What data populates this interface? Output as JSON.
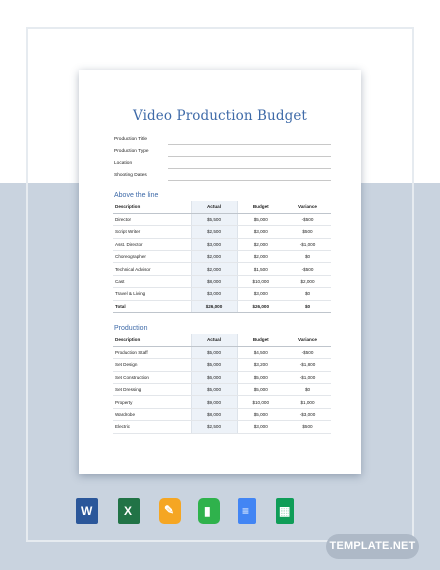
{
  "document": {
    "title": "Video Production Budget",
    "info_fields": [
      "Production Title",
      "Production Type",
      "Location",
      "Shooting Dates"
    ]
  },
  "sections": [
    {
      "title": "Above the line",
      "columns": [
        "Description",
        "Actual",
        "Budget",
        "Variance"
      ],
      "rows": [
        [
          "Director",
          "$5,500",
          "$5,000",
          "-$500"
        ],
        [
          "Script Writer",
          "$2,500",
          "$3,000",
          "$500"
        ],
        [
          "Asst. Director",
          "$3,000",
          "$2,000",
          "-$1,000"
        ],
        [
          "Choreographer",
          "$2,000",
          "$2,000",
          "$0"
        ],
        [
          "Technical Advisor",
          "$2,000",
          "$1,500",
          "-$500"
        ],
        [
          "Cast",
          "$8,000",
          "$10,000",
          "$2,000"
        ],
        [
          "Travel & Living",
          "$3,000",
          "$3,000",
          "$0"
        ]
      ],
      "total": [
        "Total",
        "$26,000",
        "$26,000",
        "$0"
      ]
    },
    {
      "title": "Production",
      "columns": [
        "Description",
        "Actual",
        "Budget",
        "Variance"
      ],
      "rows": [
        [
          "Production Staff",
          "$5,000",
          "$4,500",
          "-$500"
        ],
        [
          "Set Design",
          "$5,000",
          "$3,200",
          "-$1,800"
        ],
        [
          "Set Construction",
          "$6,000",
          "$5,000",
          "-$1,000"
        ],
        [
          "Set Dressing",
          "$5,000",
          "$5,000",
          "$0"
        ],
        [
          "Property",
          "$9,000",
          "$10,000",
          "$1,000"
        ],
        [
          "Wardrobe",
          "$8,000",
          "$5,000",
          "-$3,000"
        ],
        [
          "Electric",
          "$2,500",
          "$3,000",
          "$500"
        ]
      ]
    }
  ],
  "format_icons": [
    {
      "name": "word-icon",
      "color": "#2b579a",
      "glyph": "W"
    },
    {
      "name": "excel-icon",
      "color": "#217346",
      "glyph": "X"
    },
    {
      "name": "pages-icon",
      "color": "#f5a623",
      "glyph": "✎"
    },
    {
      "name": "numbers-icon",
      "color": "#2fb24c",
      "glyph": "▮"
    },
    {
      "name": "google-docs-icon",
      "color": "#4285f4",
      "glyph": "≡"
    },
    {
      "name": "google-sheets-icon",
      "color": "#0f9d58",
      "glyph": "▦"
    }
  ],
  "brand": "TEMPLATE.NET"
}
